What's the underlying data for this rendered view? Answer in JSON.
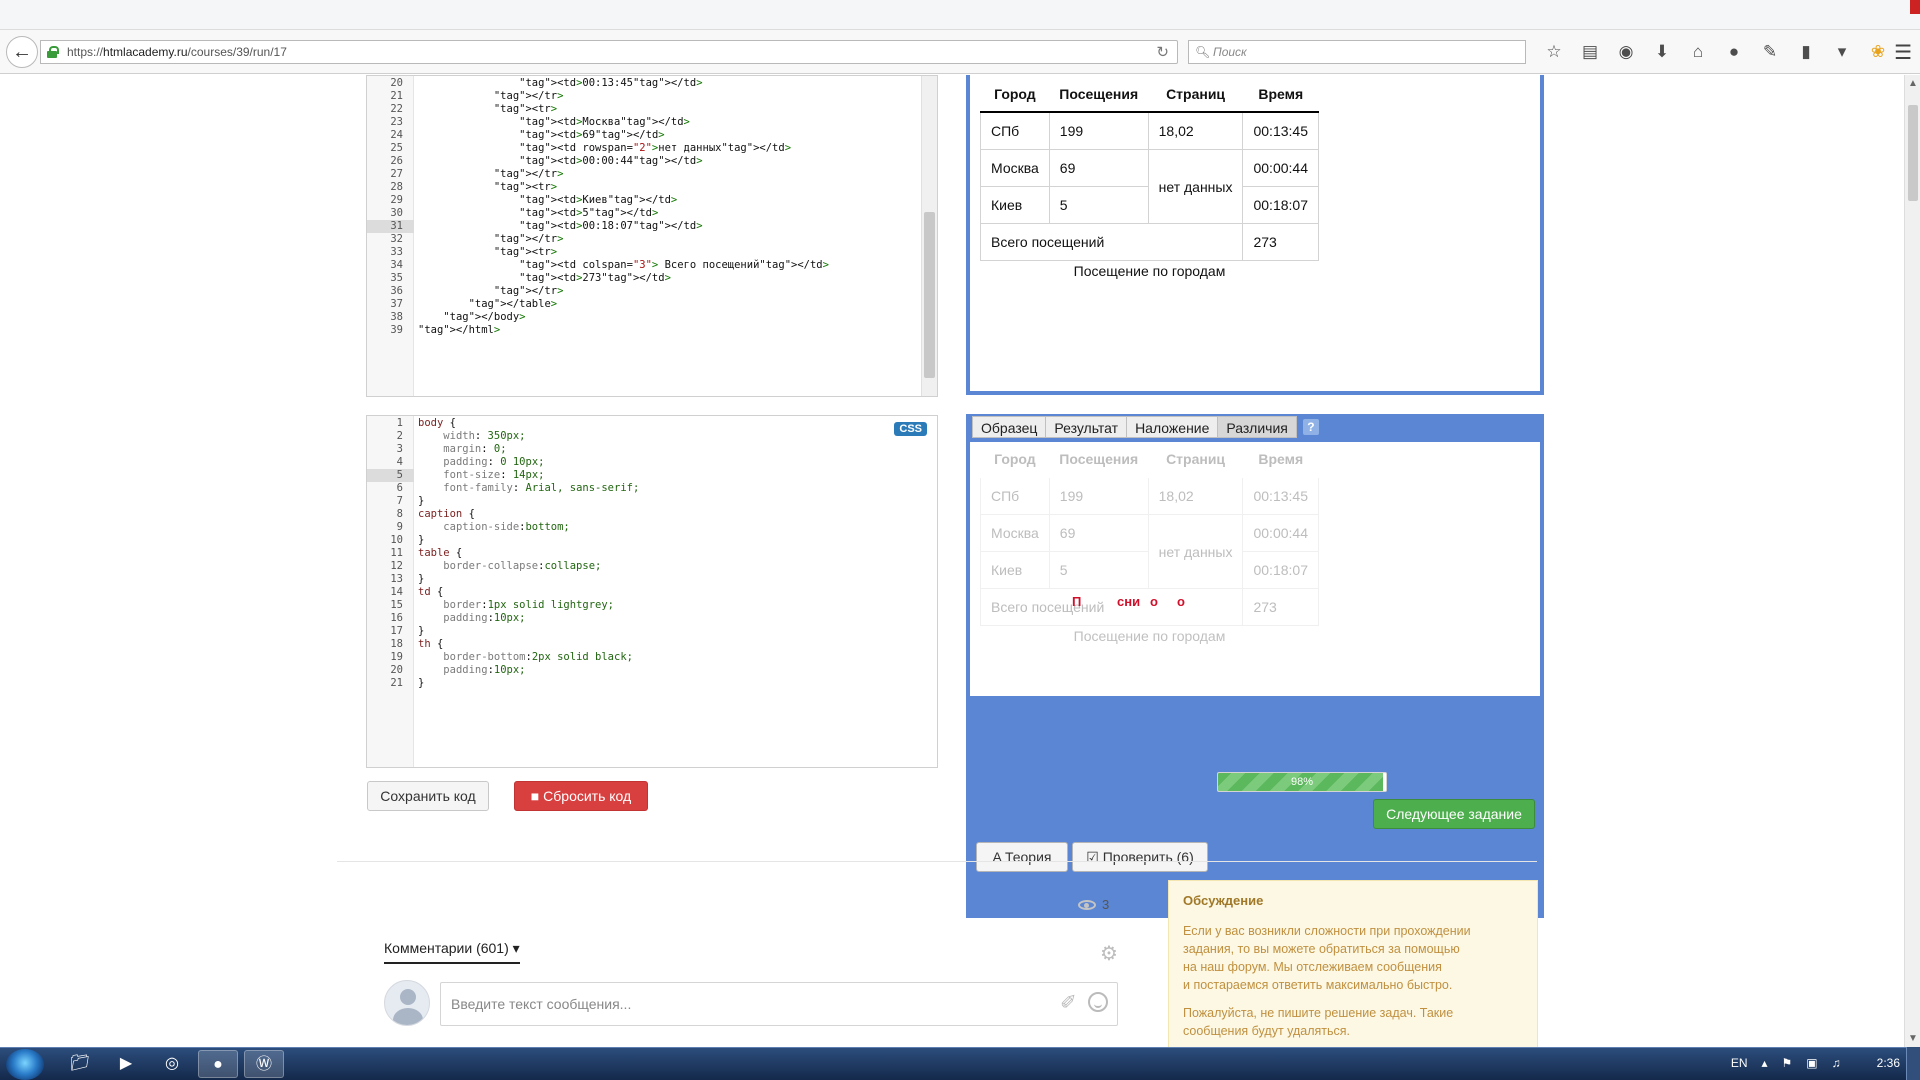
{
  "browser": {
    "url_prefix": "https://",
    "url_host": "htmlacademy.ru",
    "url_path": "/courses/39/run/17",
    "search_placeholder": "Поиск"
  },
  "html_editor": {
    "lines": [
      {
        "n": "20",
        "t": "                <td>00:13:45</td>"
      },
      {
        "n": "21",
        "t": "            </tr>"
      },
      {
        "n": "22",
        "t": "            <tr>"
      },
      {
        "n": "23",
        "t": "                <td>Москва</td>"
      },
      {
        "n": "24",
        "t": "                <td>69</td>"
      },
      {
        "n": "25",
        "t": "                <td rowspan=\"2\">нет данных</td>"
      },
      {
        "n": "26",
        "t": "                <td>00:00:44</td>"
      },
      {
        "n": "27",
        "t": "            </tr>"
      },
      {
        "n": "28",
        "t": "            <tr>"
      },
      {
        "n": "29",
        "t": "                <td>Киев</td>"
      },
      {
        "n": "30",
        "t": "                <td>5</td>"
      },
      {
        "n": "31",
        "t": "                <td>00:18:07</td>"
      },
      {
        "n": "32",
        "t": "            </tr>"
      },
      {
        "n": "33",
        "t": "            <tr>"
      },
      {
        "n": "34",
        "t": "                <td colspan=\"3\"> Всего посещений</td>"
      },
      {
        "n": "35",
        "t": "                <td>273</td>"
      },
      {
        "n": "36",
        "t": "            </tr>"
      },
      {
        "n": "37",
        "t": "        </table>"
      },
      {
        "n": "38",
        "t": "    </body>"
      },
      {
        "n": "39",
        "t": "</html>"
      }
    ],
    "active_line": "31"
  },
  "css_editor": {
    "badge": "CSS",
    "lines": [
      {
        "n": "1",
        "t": "body {"
      },
      {
        "n": "2",
        "t": "    width: 350px;"
      },
      {
        "n": "3",
        "t": "    margin: 0;"
      },
      {
        "n": "4",
        "t": "    padding: 0 10px;"
      },
      {
        "n": "5",
        "t": "    font-size: 14px;"
      },
      {
        "n": "6",
        "t": "    font-family: Arial, sans-serif;"
      },
      {
        "n": "7",
        "t": "}"
      },
      {
        "n": "8",
        "t": "caption {"
      },
      {
        "n": "9",
        "t": "    caption-side:bottom;"
      },
      {
        "n": "10",
        "t": "}"
      },
      {
        "n": "11",
        "t": "table {"
      },
      {
        "n": "12",
        "t": "    border-collapse:collapse;"
      },
      {
        "n": "13",
        "t": "}"
      },
      {
        "n": "14",
        "t": "td {"
      },
      {
        "n": "15",
        "t": "    border:1px solid lightgrey;"
      },
      {
        "n": "16",
        "t": "    padding:10px;"
      },
      {
        "n": "17",
        "t": "}"
      },
      {
        "n": "18",
        "t": "th {"
      },
      {
        "n": "19",
        "t": "    border-bottom:2px solid black;"
      },
      {
        "n": "20",
        "t": "    padding:10px;"
      },
      {
        "n": "21",
        "t": "}"
      }
    ],
    "active_line": "5"
  },
  "editor_buttons": {
    "save": "Сохранить код",
    "reset": "Сбросить код"
  },
  "result_table": {
    "headers": [
      "Город",
      "Посещения",
      "Страниц",
      "Время"
    ],
    "rows": {
      "r1": {
        "city": "СПб",
        "visits": "199",
        "pages": "18,02",
        "time": "00:13:45"
      },
      "r2": {
        "city": "Москва",
        "visits": "69",
        "pages": "нет данных",
        "time": "00:00:44"
      },
      "r3": {
        "city": "Киев",
        "visits": "5",
        "time": "00:18:07"
      },
      "total": {
        "label": "Всего посещений",
        "value": "273"
      }
    },
    "caption": "Посещение по городам"
  },
  "compare_panel": {
    "tabs": [
      "Образец",
      "Результат",
      "Наложение",
      "Различия"
    ],
    "active_tab": "Различия",
    "help": "?",
    "diff_marks": [
      "П",
      "сни",
      "о",
      "о"
    ]
  },
  "actions": {
    "theory": "Теория",
    "check": "Проверить (6)",
    "progress_label": "98%",
    "progress_value": 0.98,
    "next": "Следующее задание"
  },
  "comments": {
    "views": "3",
    "tab_label": "Комментарии (601)",
    "input_placeholder": "Введите текст сообщения..."
  },
  "discussion": {
    "title": "Обсуждение",
    "text1": "Если у вас возникли сложности при прохождении\nзадания, то вы можете обратиться за помощью\nна наш форум. Мы отслеживаем сообщения\nи постараемся ответить максимально быстро.",
    "text2": "Пожалуйста, не пишите решение задач. Такие\nсообщения будут удаляться."
  },
  "taskbar": {
    "lang": "EN",
    "clock": "2:36"
  },
  "colors": {
    "panel_blue": "#5b86d3",
    "progress_green": "#5cb85c",
    "next_green": "#4cae4c",
    "reset_red": "#d84040",
    "diff_red": "#d0102a"
  }
}
